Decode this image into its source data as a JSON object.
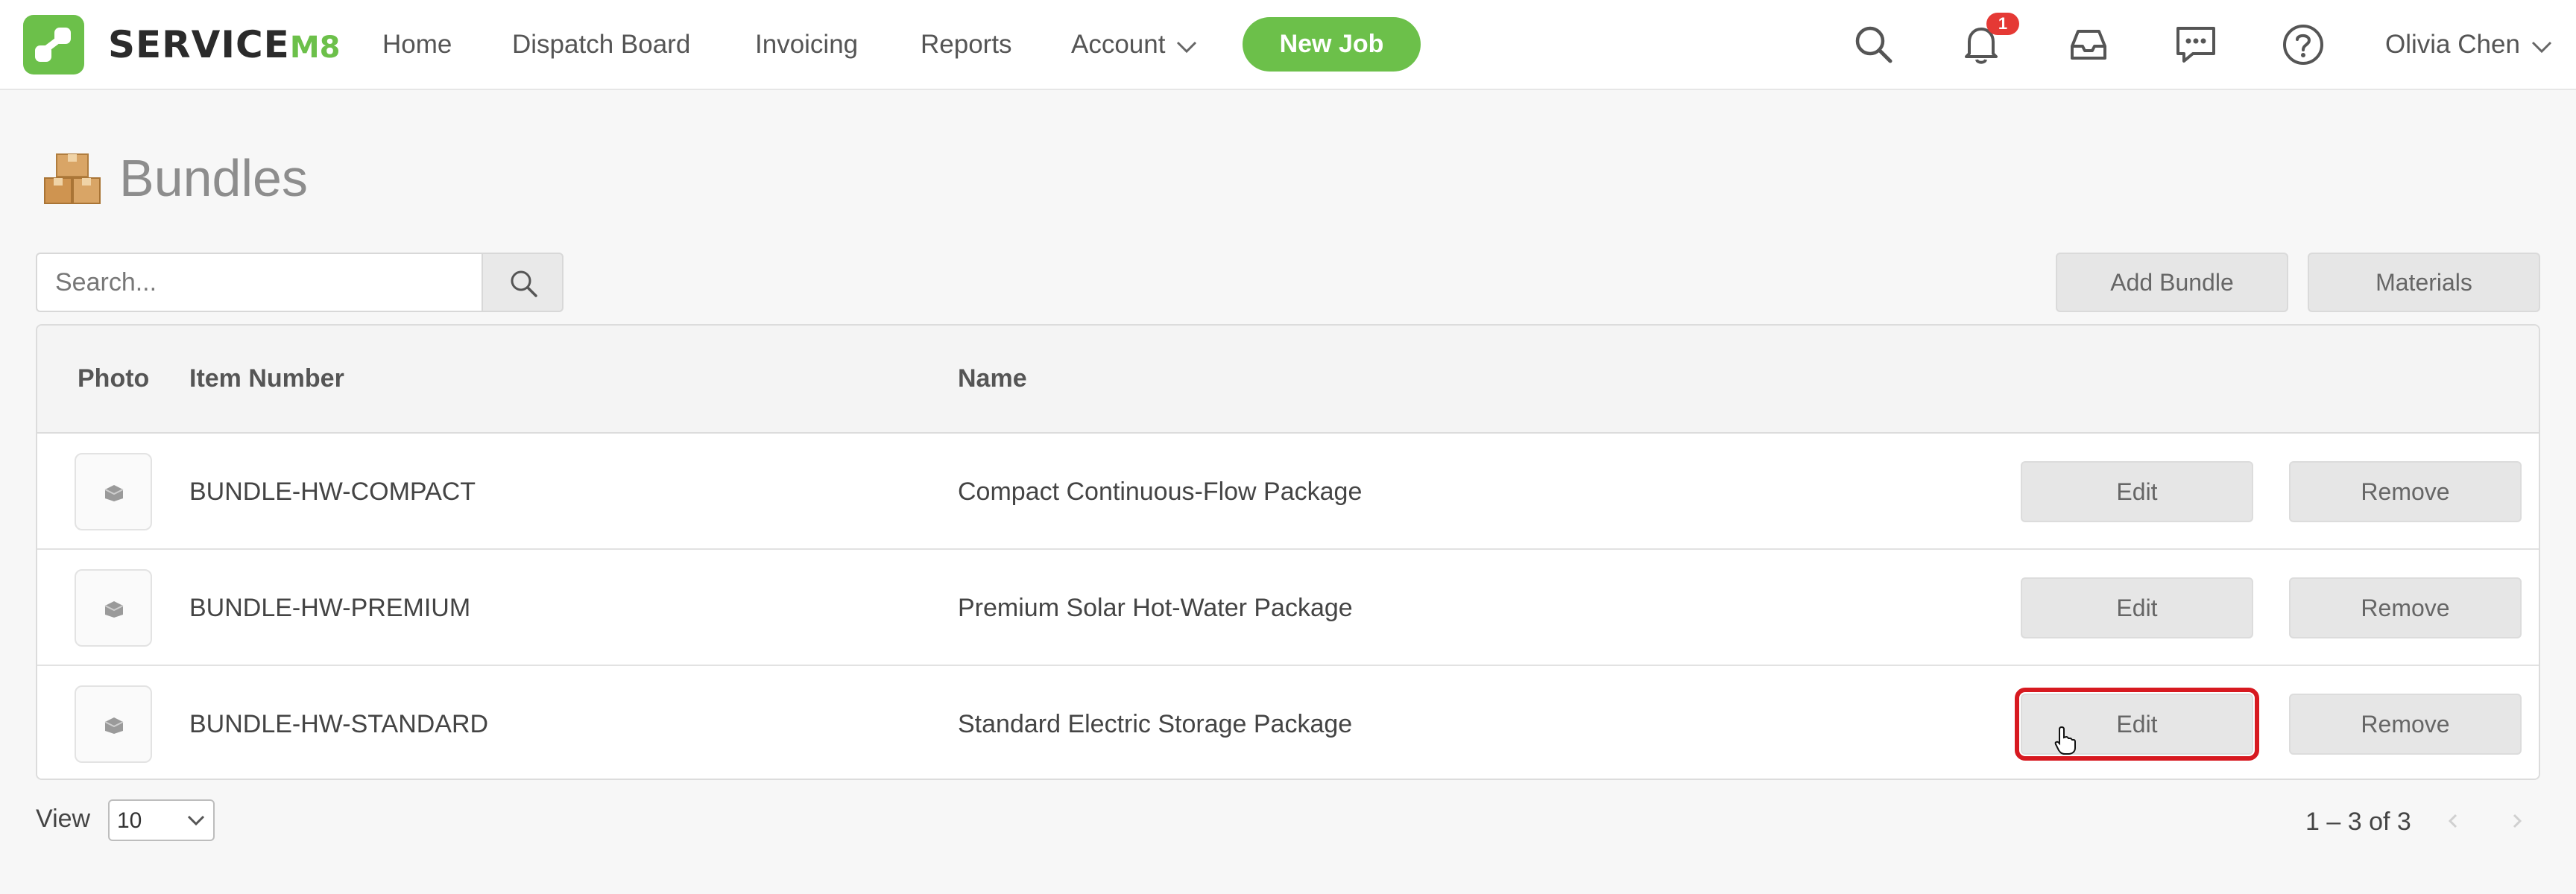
{
  "app": {
    "logo_text": "SERVICE",
    "logo_suffix": "M8",
    "brand_color": "#6cc04a"
  },
  "nav": {
    "items": [
      {
        "label": "Home"
      },
      {
        "label": "Dispatch Board"
      },
      {
        "label": "Invoicing"
      },
      {
        "label": "Reports"
      },
      {
        "label": "Account"
      }
    ],
    "new_job_label": "New Job",
    "notification_count": "1",
    "user_name": "Olivia Chen",
    "icons": [
      "search-icon",
      "bell-icon",
      "inbox-icon",
      "chat-icon",
      "help-icon"
    ]
  },
  "page": {
    "title": "Bundles",
    "icon": "boxes-icon"
  },
  "toolbar": {
    "search_placeholder": "Search...",
    "add_bundle_label": "Add Bundle",
    "materials_label": "Materials"
  },
  "table": {
    "columns": {
      "photo": "Photo",
      "item_number": "Item Number",
      "name": "Name"
    },
    "rows": [
      {
        "item_number": "BUNDLE-HW-COMPACT",
        "name": "Compact Continuous-Flow Package",
        "edit": "Edit",
        "remove": "Remove"
      },
      {
        "item_number": "BUNDLE-HW-PREMIUM",
        "name": "Premium Solar Hot-Water Package",
        "edit": "Edit",
        "remove": "Remove"
      },
      {
        "item_number": "BUNDLE-HW-STANDARD",
        "name": "Standard Electric Storage Package",
        "edit": "Edit",
        "remove": "Remove"
      }
    ],
    "focused_row": 2,
    "focus_color": "#d71920"
  },
  "footer": {
    "view_label": "View",
    "view_value": "10",
    "page_info": "1 – 3 of 3"
  }
}
